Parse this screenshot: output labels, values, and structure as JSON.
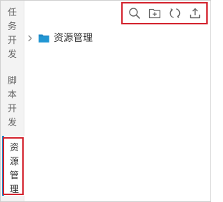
{
  "sidebar": {
    "tabs": [
      {
        "label": "任务开发"
      },
      {
        "label": "脚本开发"
      },
      {
        "label": "资源管理"
      }
    ]
  },
  "toolbar": {
    "buttons": [
      {
        "icon": "search-icon"
      },
      {
        "icon": "new-folder-icon"
      },
      {
        "icon": "refresh-icon"
      },
      {
        "icon": "upload-icon"
      }
    ]
  },
  "tree": {
    "root_label": "资源管理"
  },
  "colors": {
    "accent": "#1e88c7",
    "highlight": "#d3212c",
    "icon": "#666666"
  }
}
